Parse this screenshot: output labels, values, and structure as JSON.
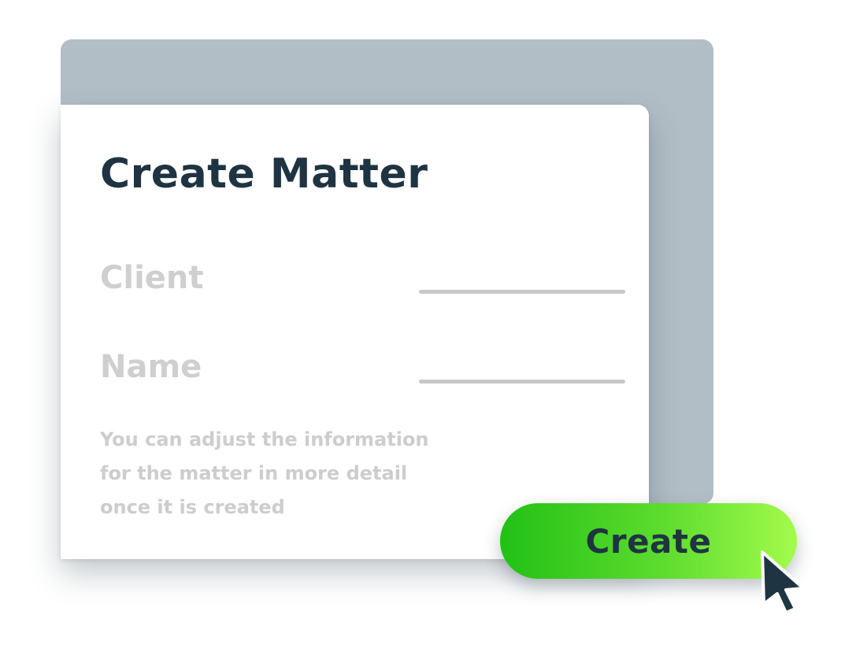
{
  "dialog": {
    "title": "Create Matter",
    "fields": [
      {
        "label": "Client",
        "value": ""
      },
      {
        "label": "Name",
        "value": ""
      }
    ],
    "help_lines": [
      "You can adjust the information",
      "for the matter in more detail",
      "once it is created"
    ],
    "create_button_label": "Create"
  },
  "icons": {
    "cursor": "mouse-pointer-icon"
  },
  "colors": {
    "backdrop": "#b2bec6",
    "card": "#ffffff",
    "title_text": "#1f3442",
    "muted_text": "#cdcdcd",
    "field_line": "#c7c7c7",
    "button_gradient_start": "#22c015",
    "button_gradient_end": "#a3fb4c",
    "button_text": "#1f3442",
    "cursor": "#1f3442"
  }
}
